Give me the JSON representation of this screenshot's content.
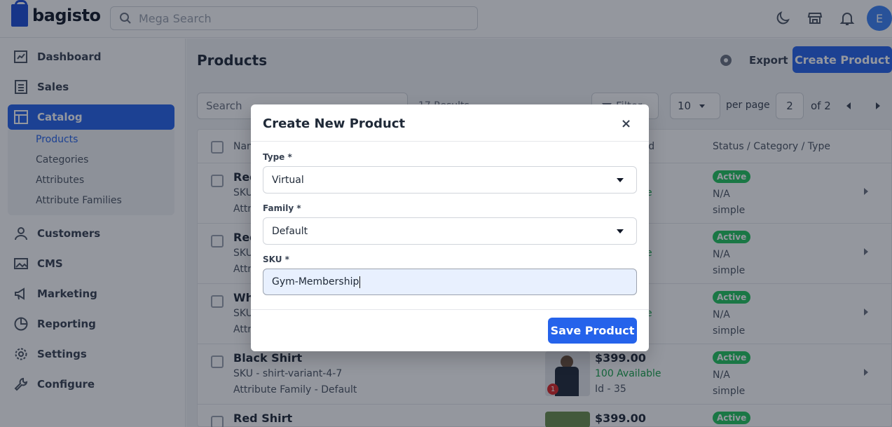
{
  "header": {
    "brand": "bagisto",
    "search_placeholder": "Mega Search",
    "avatar_initial": "E"
  },
  "sidebar": {
    "items": [
      {
        "label": "Dashboard",
        "icon": "dashboard-icon"
      },
      {
        "label": "Sales",
        "icon": "sales-icon"
      },
      {
        "label": "Catalog",
        "icon": "catalog-icon",
        "active": true
      },
      {
        "label": "Customers",
        "icon": "customers-icon"
      },
      {
        "label": "CMS",
        "icon": "cms-icon"
      },
      {
        "label": "Marketing",
        "icon": "marketing-icon"
      },
      {
        "label": "Reporting",
        "icon": "reporting-icon"
      },
      {
        "label": "Settings",
        "icon": "settings-icon"
      },
      {
        "label": "Configure",
        "icon": "configure-icon"
      }
    ],
    "catalog_sub": [
      "Products",
      "Categories",
      "Attributes",
      "Attribute Families"
    ]
  },
  "page": {
    "title": "Products",
    "export_label": "Export",
    "create_label": "Create Product",
    "search_placeholder": "Search",
    "results_text": "17 Results",
    "filter_label": "Filter",
    "per_page_value": "10",
    "per_page_label": "per page",
    "page_value": "2",
    "of_label": "of 2"
  },
  "table": {
    "col_name": "Nam",
    "col_price": "/ Id",
    "col_status": "Status / Category / Type",
    "rows": [
      {
        "title": "Red",
        "sku": "SKU",
        "family": "Attr",
        "price": "",
        "avail": "e",
        "id": "",
        "status": "Active",
        "category": "N/A",
        "type": "simple"
      },
      {
        "title": "Red",
        "sku": "SKU",
        "family": "Attr",
        "price": "",
        "avail": "e",
        "id": "",
        "status": "Active",
        "category": "N/A",
        "type": "simple"
      },
      {
        "title": "Wh",
        "sku": "SKU",
        "family": "Attr",
        "price": "",
        "avail": "e",
        "id": "",
        "status": "Active",
        "category": "N/A",
        "type": "simple"
      },
      {
        "title": "Black Shirt",
        "sku": "SKU - shirt-variant-4-7",
        "family": "Attribute Family - Default",
        "price": "$399.00",
        "avail": "100 Available",
        "id": "Id - 35",
        "status": "Active",
        "category": "N/A",
        "type": "simple",
        "img_badge": "1"
      },
      {
        "title": "Red Shirt",
        "sku": "",
        "family": "",
        "price": "$399.00",
        "avail": "",
        "id": "",
        "status": "Active",
        "category": "",
        "type": ""
      }
    ]
  },
  "modal": {
    "title": "Create New Product",
    "close": "×",
    "type_label": "Type *",
    "type_value": "Virtual",
    "family_label": "Family *",
    "family_value": "Default",
    "sku_label": "SKU *",
    "sku_value": "Gym-Membership",
    "save_label": "Save Product"
  }
}
